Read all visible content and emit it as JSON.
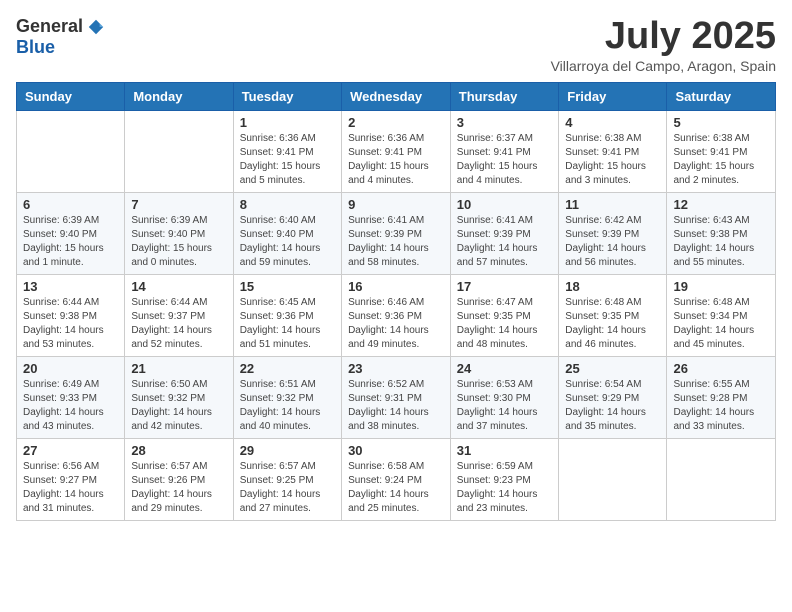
{
  "logo": {
    "general": "General",
    "blue": "Blue"
  },
  "title": {
    "month_year": "July 2025",
    "location": "Villarroya del Campo, Aragon, Spain"
  },
  "headers": [
    "Sunday",
    "Monday",
    "Tuesday",
    "Wednesday",
    "Thursday",
    "Friday",
    "Saturday"
  ],
  "weeks": [
    [
      {
        "day": "",
        "info": ""
      },
      {
        "day": "",
        "info": ""
      },
      {
        "day": "1",
        "info": "Sunrise: 6:36 AM\nSunset: 9:41 PM\nDaylight: 15 hours\nand 5 minutes."
      },
      {
        "day": "2",
        "info": "Sunrise: 6:36 AM\nSunset: 9:41 PM\nDaylight: 15 hours\nand 4 minutes."
      },
      {
        "day": "3",
        "info": "Sunrise: 6:37 AM\nSunset: 9:41 PM\nDaylight: 15 hours\nand 4 minutes."
      },
      {
        "day": "4",
        "info": "Sunrise: 6:38 AM\nSunset: 9:41 PM\nDaylight: 15 hours\nand 3 minutes."
      },
      {
        "day": "5",
        "info": "Sunrise: 6:38 AM\nSunset: 9:41 PM\nDaylight: 15 hours\nand 2 minutes."
      }
    ],
    [
      {
        "day": "6",
        "info": "Sunrise: 6:39 AM\nSunset: 9:40 PM\nDaylight: 15 hours\nand 1 minute."
      },
      {
        "day": "7",
        "info": "Sunrise: 6:39 AM\nSunset: 9:40 PM\nDaylight: 15 hours\nand 0 minutes."
      },
      {
        "day": "8",
        "info": "Sunrise: 6:40 AM\nSunset: 9:40 PM\nDaylight: 14 hours\nand 59 minutes."
      },
      {
        "day": "9",
        "info": "Sunrise: 6:41 AM\nSunset: 9:39 PM\nDaylight: 14 hours\nand 58 minutes."
      },
      {
        "day": "10",
        "info": "Sunrise: 6:41 AM\nSunset: 9:39 PM\nDaylight: 14 hours\nand 57 minutes."
      },
      {
        "day": "11",
        "info": "Sunrise: 6:42 AM\nSunset: 9:39 PM\nDaylight: 14 hours\nand 56 minutes."
      },
      {
        "day": "12",
        "info": "Sunrise: 6:43 AM\nSunset: 9:38 PM\nDaylight: 14 hours\nand 55 minutes."
      }
    ],
    [
      {
        "day": "13",
        "info": "Sunrise: 6:44 AM\nSunset: 9:38 PM\nDaylight: 14 hours\nand 53 minutes."
      },
      {
        "day": "14",
        "info": "Sunrise: 6:44 AM\nSunset: 9:37 PM\nDaylight: 14 hours\nand 52 minutes."
      },
      {
        "day": "15",
        "info": "Sunrise: 6:45 AM\nSunset: 9:36 PM\nDaylight: 14 hours\nand 51 minutes."
      },
      {
        "day": "16",
        "info": "Sunrise: 6:46 AM\nSunset: 9:36 PM\nDaylight: 14 hours\nand 49 minutes."
      },
      {
        "day": "17",
        "info": "Sunrise: 6:47 AM\nSunset: 9:35 PM\nDaylight: 14 hours\nand 48 minutes."
      },
      {
        "day": "18",
        "info": "Sunrise: 6:48 AM\nSunset: 9:35 PM\nDaylight: 14 hours\nand 46 minutes."
      },
      {
        "day": "19",
        "info": "Sunrise: 6:48 AM\nSunset: 9:34 PM\nDaylight: 14 hours\nand 45 minutes."
      }
    ],
    [
      {
        "day": "20",
        "info": "Sunrise: 6:49 AM\nSunset: 9:33 PM\nDaylight: 14 hours\nand 43 minutes."
      },
      {
        "day": "21",
        "info": "Sunrise: 6:50 AM\nSunset: 9:32 PM\nDaylight: 14 hours\nand 42 minutes."
      },
      {
        "day": "22",
        "info": "Sunrise: 6:51 AM\nSunset: 9:32 PM\nDaylight: 14 hours\nand 40 minutes."
      },
      {
        "day": "23",
        "info": "Sunrise: 6:52 AM\nSunset: 9:31 PM\nDaylight: 14 hours\nand 38 minutes."
      },
      {
        "day": "24",
        "info": "Sunrise: 6:53 AM\nSunset: 9:30 PM\nDaylight: 14 hours\nand 37 minutes."
      },
      {
        "day": "25",
        "info": "Sunrise: 6:54 AM\nSunset: 9:29 PM\nDaylight: 14 hours\nand 35 minutes."
      },
      {
        "day": "26",
        "info": "Sunrise: 6:55 AM\nSunset: 9:28 PM\nDaylight: 14 hours\nand 33 minutes."
      }
    ],
    [
      {
        "day": "27",
        "info": "Sunrise: 6:56 AM\nSunset: 9:27 PM\nDaylight: 14 hours\nand 31 minutes."
      },
      {
        "day": "28",
        "info": "Sunrise: 6:57 AM\nSunset: 9:26 PM\nDaylight: 14 hours\nand 29 minutes."
      },
      {
        "day": "29",
        "info": "Sunrise: 6:57 AM\nSunset: 9:25 PM\nDaylight: 14 hours\nand 27 minutes."
      },
      {
        "day": "30",
        "info": "Sunrise: 6:58 AM\nSunset: 9:24 PM\nDaylight: 14 hours\nand 25 minutes."
      },
      {
        "day": "31",
        "info": "Sunrise: 6:59 AM\nSunset: 9:23 PM\nDaylight: 14 hours\nand 23 minutes."
      },
      {
        "day": "",
        "info": ""
      },
      {
        "day": "",
        "info": ""
      }
    ]
  ]
}
